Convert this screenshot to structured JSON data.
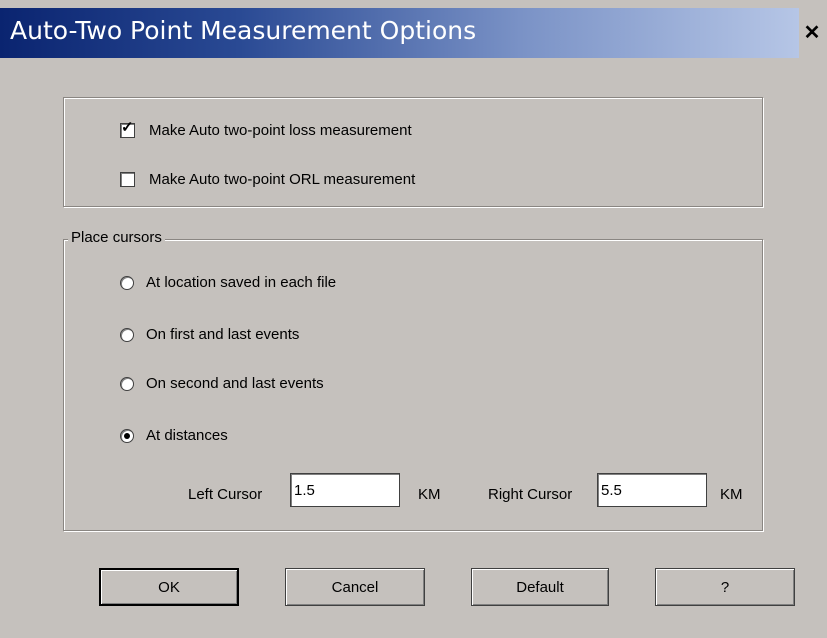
{
  "window": {
    "title": "Auto-Two Point Measurement Options",
    "close_glyph": "✕"
  },
  "measurements": {
    "loss": {
      "label": "Make Auto two-point loss measurement",
      "checked": true
    },
    "orl": {
      "label": "Make Auto two-point ORL measurement",
      "checked": false
    }
  },
  "place_cursors": {
    "legend": "Place cursors",
    "options": [
      {
        "label": "At location saved in each file",
        "selected": false
      },
      {
        "label": "On first and last events",
        "selected": false
      },
      {
        "label": "On second and last events",
        "selected": false
      },
      {
        "label": "At distances",
        "selected": true
      }
    ],
    "left_cursor": {
      "label": "Left Cursor",
      "value": "1.5",
      "unit": "KM"
    },
    "right_cursor": {
      "label": "Right Cursor",
      "value": "5.5",
      "unit": "KM"
    }
  },
  "buttons": {
    "ok": "OK",
    "cancel": "Cancel",
    "default": "Default",
    "help": "?"
  },
  "colors": {
    "dialog_bg": "#c5c1bd",
    "title_start": "#0a2470",
    "title_end": "#b6c6e6"
  }
}
